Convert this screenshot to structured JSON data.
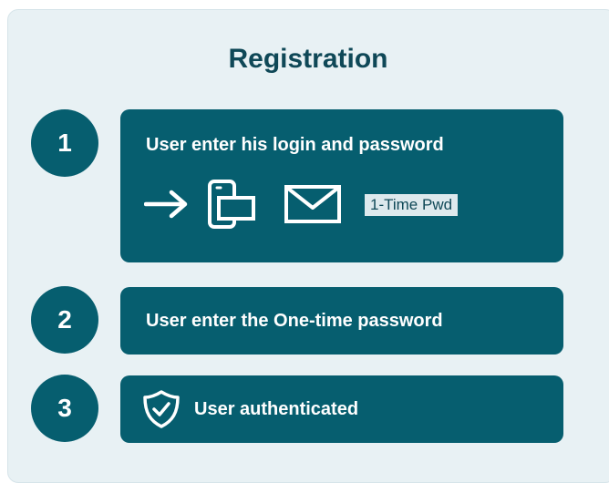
{
  "title": "Registration",
  "steps": [
    {
      "number": "1",
      "text": "User enter his login and password",
      "badge": "1-Time Pwd"
    },
    {
      "number": "2",
      "text": "User enter the One-time password"
    },
    {
      "number": "3",
      "text": "User authenticated"
    }
  ],
  "icons": [
    "arrow-right-icon",
    "mobile-device-icon",
    "envelope-icon",
    "shield-check-icon"
  ],
  "colors": {
    "card": "#065e6f",
    "background": "#e8f1f4",
    "title": "#0f4857"
  }
}
